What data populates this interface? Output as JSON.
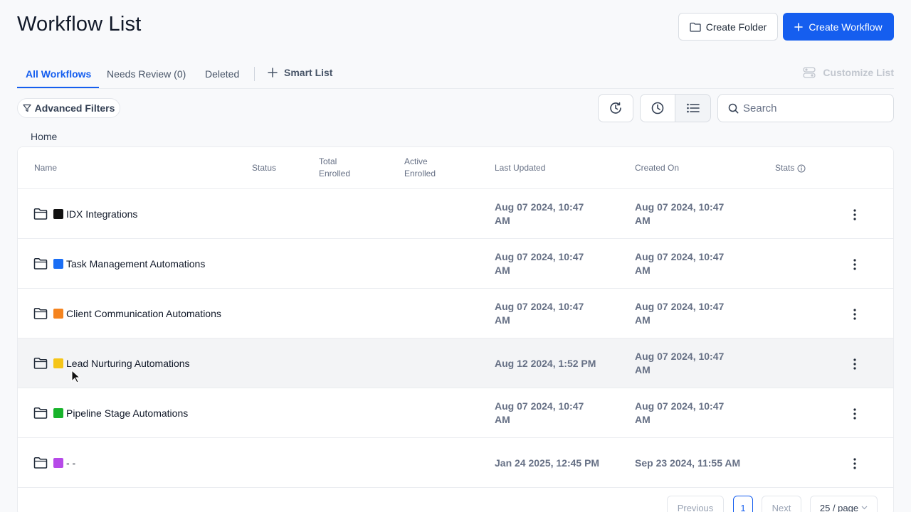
{
  "header": {
    "title": "Workflow List",
    "create_folder_label": "Create Folder",
    "create_workflow_label": "Create Workflow"
  },
  "tabs": [
    {
      "label": "All Workflows",
      "active": true
    },
    {
      "label": "Needs Review (0)",
      "active": false
    },
    {
      "label": "Deleted",
      "active": false
    }
  ],
  "smart_list_label": "Smart List",
  "customize_list_label": "Customize List",
  "filters": {
    "advanced_filters_label": "Advanced Filters",
    "search_placeholder": "Search"
  },
  "breadcrumb": "Home",
  "table": {
    "columns": {
      "name": "Name",
      "status": "Status",
      "total_enrolled": "Total Enrolled",
      "active_enrolled": "Active Enrolled",
      "last_updated": "Last Updated",
      "created_on": "Created On",
      "stats": "Stats"
    },
    "rows": [
      {
        "name": "IDX Integrations",
        "color": "#111111",
        "last_updated": "Aug 07 2024, 10:47 AM",
        "created_on": "Aug 07 2024, 10:47 AM"
      },
      {
        "name": "Task Management Automations",
        "color": "#1a6ef5",
        "last_updated": "Aug 07 2024, 10:47 AM",
        "created_on": "Aug 07 2024, 10:47 AM"
      },
      {
        "name": "Client Communication Automations",
        "color": "#f5841f",
        "last_updated": "Aug 07 2024, 10:47 AM",
        "created_on": "Aug 07 2024, 10:47 AM"
      },
      {
        "name": "Lead Nurturing Automations",
        "color": "#f5c518",
        "last_updated": "Aug 12 2024, 1:52 PM",
        "created_on": "Aug 07 2024, 10:47 AM"
      },
      {
        "name": "Pipeline Stage Automations",
        "color": "#18b32b",
        "last_updated": "Aug 07 2024, 10:47 AM",
        "created_on": "Aug 07 2024, 10:47 AM"
      },
      {
        "name": "- -",
        "color": "#b64ae8",
        "last_updated": "Jan 24 2025, 12:45 PM",
        "created_on": "Sep 23 2024, 11:55 AM"
      }
    ]
  },
  "pagination": {
    "previous_label": "Previous",
    "current_page": "1",
    "next_label": "Next",
    "page_size_label": "25 / page"
  },
  "colors": {
    "accent": "#155eef",
    "hover_row": "#f3f4f6"
  }
}
